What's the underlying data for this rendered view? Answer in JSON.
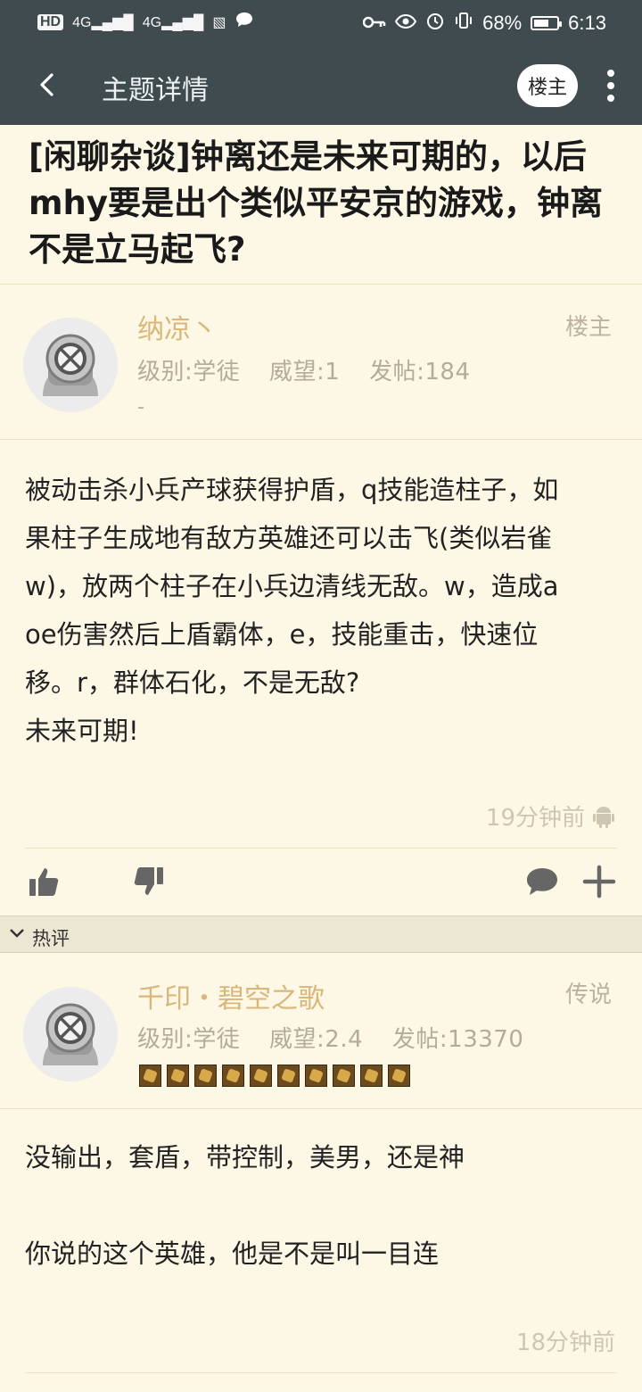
{
  "status_bar": {
    "left_icons": [
      "hd-icon",
      "signal-4g-icon",
      "signal-4g-icon",
      "nfc-icon",
      "message-bubble-icon"
    ],
    "hd": "HD",
    "net1": "4G",
    "net2": "4G",
    "battery_percent": "68%",
    "battery_level": 0.68,
    "time": "6:13"
  },
  "app_bar": {
    "title": "主题详情",
    "op_button": "楼主"
  },
  "thread": {
    "title": "[闲聊杂谈]钟离还是未来可期的，以后mhy要是出个类似平安京的游戏，钟离不是立马起飞?"
  },
  "post": {
    "author": "纳凉丶",
    "tag": "楼主",
    "meta": {
      "level": "级别:学徒",
      "prestige": "威望:1",
      "posts": "发帖:184"
    },
    "signature": "-",
    "content_lines": [
      "被动击杀小兵产球获得护盾，q技能造柱子，如",
      "果柱子生成地有敌方英雄还可以击飞(类似岩雀",
      "w)，放两个柱子在小兵边清线无敌。w，造成a",
      "oe伤害然后上盾霸体，e，技能重击，快速位",
      "移。r，群体石化，不是无敌?",
      "未来可期!"
    ],
    "time": "19分钟前"
  },
  "hot_section": {
    "label": "热评"
  },
  "reply": {
    "author": "千印・碧空之歌",
    "tag": "传说",
    "meta": {
      "level": "级别:学徒",
      "prestige": "威望:2.4",
      "posts": "发帖:13370"
    },
    "badge_count": 10,
    "content_lines": [
      "没输出，套盾，带控制，美男，还是神",
      "",
      "你说的这个英雄，他是不是叫一目连"
    ],
    "time": "18分钟前"
  },
  "colors": {
    "header_bg": "#3f4b4f",
    "page_bg": "#fdf8e6",
    "author_name": "#d9b679",
    "muted_text": "#b5ab98"
  }
}
